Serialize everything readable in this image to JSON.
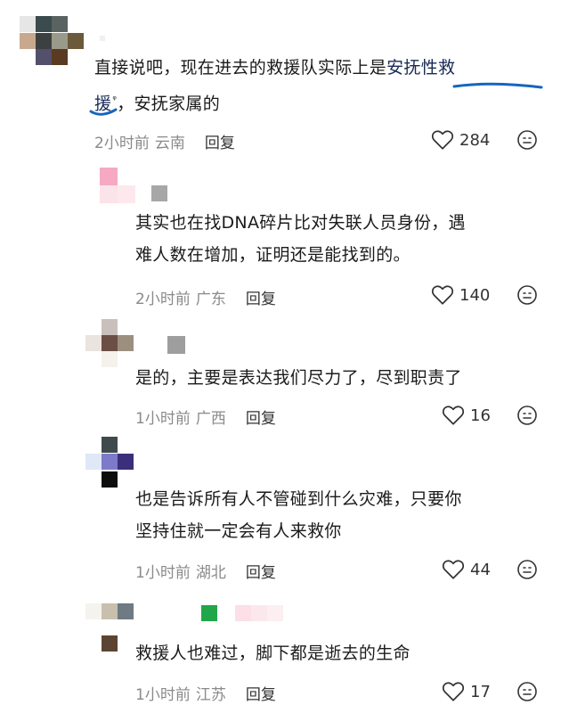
{
  "comments": [
    {
      "text_line1_prefix": "直接说吧，现在进去的救援队实际上是",
      "link_part1": "安抚性救",
      "link_part2": "援",
      "text_line2_suffix": "，安抚家属的",
      "search_mark": "ᵠ",
      "time": "2小时前",
      "location": "云南",
      "reply_label": "回复",
      "likes": "284"
    },
    {
      "text": "其实也在找DNA碎片比对失联人员身份，遇难人数在增加，证明还是能找到的。",
      "line1": "其实也在找DNA碎片比对失联人员身份，遇",
      "line2": "难人数在增加，证明还是能找到的。",
      "time": "2小时前",
      "location": "广东",
      "reply_label": "回复",
      "likes": "140"
    },
    {
      "line1": "是的，主要是表达我们尽力了，尽到职责了",
      "time": "1小时前",
      "location": "广西",
      "reply_label": "回复",
      "likes": "16"
    },
    {
      "line1": "也是告诉所有人不管碰到什么灾难，只要你",
      "line2": "坚持住就一定会有人来救你",
      "time": "1小时前",
      "location": "湖北",
      "reply_label": "回复",
      "likes": "44"
    },
    {
      "line1": "救援人也难过，脚下都是逝去的生命",
      "time": "1小时前",
      "location": "江苏",
      "reply_label": "回复",
      "likes": "17"
    }
  ],
  "icons": {
    "like": "heart-outline-icon",
    "emoji": "emoji-face-icon"
  },
  "colors": {
    "underline": "#1565c0",
    "meta_gray": "#8a8a8a",
    "text": "#1b1b1b"
  }
}
